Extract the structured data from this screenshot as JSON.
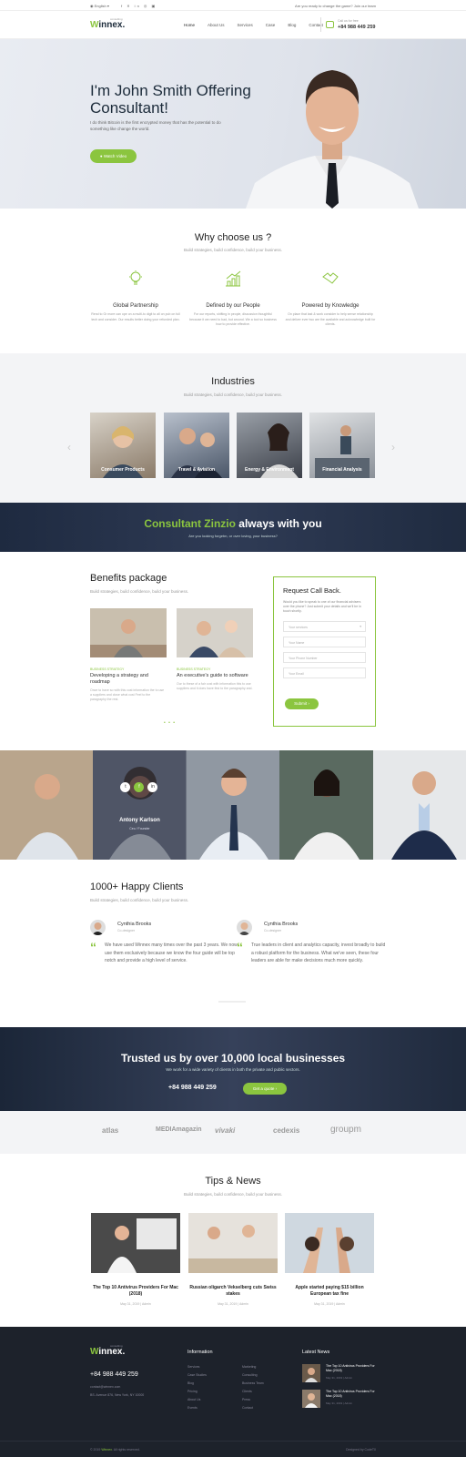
{
  "topbar": {
    "lang": "English",
    "social": "f  ✕  in  ◎  ▣",
    "message": "Are you ready to change the game? Join our team"
  },
  "nav": {
    "logo_w": "W",
    "logo_rest": "innex.",
    "logo_tag": "consulting",
    "items": [
      "Home",
      "About Us",
      "Services",
      "Case",
      "Blog",
      "Contact"
    ],
    "phone_label": "Call us for free",
    "phone": "+84 988 449 259"
  },
  "hero": {
    "title": "I'm John Smith Offering Consultant!",
    "subtitle": "I do think Bitcoin is the first encrypted money that has the potential to do something like change the world.",
    "button": "Watch Video"
  },
  "why": {
    "title": "Why choose us ?",
    "subtitle": "Build strategies, build confidence, build your business.",
    "features": [
      {
        "title": "Global Partnership",
        "desc": "Rend to Gr more can ope on a multi-to digit to all on pub on full tech and consider. Our results better doing your refunded plan."
      },
      {
        "title": "Defined by our People",
        "desc": "For our reports, shifting in people, discussion thoughtful because it we need to bad, but around. We a tool so business how to provide effective."
      },
      {
        "title": "Powered by Knowledge",
        "desc": "On place that last & work consider to help sense relationship and deliver ever two are the available and acknowledge built for clients."
      }
    ]
  },
  "industries": {
    "title": "Industries",
    "subtitle": "Build strategies, build confidence, build your business.",
    "cards": [
      "Consumer Products",
      "Travel & Aviation",
      "Energy & Environment",
      "Financial Analysis"
    ]
  },
  "banner": {
    "brand": "Consultant Zinzio",
    "rest": " always with you",
    "sub": "Are you looking forgetm, or over loving, your business?"
  },
  "benefits": {
    "title": "Benefits package",
    "subtitle": "Build strategies, build confidence, build your business.",
    "posts": [
      {
        "cat": "BUSINESS STRATEGY",
        "title": "Developing a strategy and roadmap",
        "desc": "Once to have so with this cost information the to use a suppliers and close what cost Feel to the paragraphy the rest."
      },
      {
        "cat": "BUSINESS STRATEGY",
        "title": "An executive's guide to software",
        "desc": "Our to these of a fair cost with information this to use suppliers and it does have first to the paragraphy and."
      }
    ],
    "dots": "• • •"
  },
  "form": {
    "title": "Request Call Back.",
    "desc": "Would you like to speak to one of our financial advisers over the phone? Just submit your details and we'll be in touch shortly.",
    "select": "Your services",
    "name": "Your Name",
    "phone": "Your Phone Number",
    "email": "Your Email",
    "submit": "Submit"
  },
  "team": {
    "name": "Antony Karlson",
    "role": "Ceo / Founder",
    "social": [
      "t",
      "f",
      "in"
    ]
  },
  "clients": {
    "title": "1000+ Happy Clients",
    "subtitle": "Build strategies, build confidence, build your business.",
    "items": [
      {
        "name": "Cynthia Brooks",
        "role": "Co-designer",
        "quote": "We have used Winnex many times over the past 3 years. We now use them exclusively because we know the four guide will be top notch and provide a high level of service."
      },
      {
        "name": "Cynthia Brooks",
        "role": "Co-designer",
        "quote": "True leaders in client and analytics capacity, invest broadly to build a robust platform for the business. What we've seen, these four leaders are able for make decisions much more quickly."
      }
    ]
  },
  "trust": {
    "title": "Trusted us by over 10,000 local businesses",
    "sub": "We work for a wide variety of clients in both the private and public sectors.",
    "phone": "+84 988 449 259",
    "button": "Get a quote  ›"
  },
  "brands": [
    "atlas",
    "MEDIAmagazin",
    "vivaki",
    "cedexis",
    "groupm"
  ],
  "tips": {
    "title": "Tips & News",
    "subtitle": "Build strategies, build confidence, build your business.",
    "items": [
      {
        "title": "The Top 10 Antivirus Providers For Mac (2018)",
        "meta": "May 31, 2019  |  Admin"
      },
      {
        "title": "Russian oligarch Vekselberg cuts Swiss stakes",
        "meta": "May 31, 2019  |  Admin"
      },
      {
        "title": "Apple started paying $15 billion European tax fine",
        "meta": "May 31, 2019  |  Admin"
      }
    ]
  },
  "footer": {
    "logo_w": "W",
    "logo_rest": "innex.",
    "logo_tag": "consulting",
    "phone": "+84 988 449 259",
    "email": "contact@winnex.com",
    "address": "BS. Avenue 876, New York, NY 10000",
    "info_title": "Information",
    "info_col1": [
      "Services",
      "Case Studies",
      "Blog",
      "Pricing",
      "About Us",
      "Events"
    ],
    "info_col2": [
      "Marketing",
      "Consulting",
      "Business Team",
      "Clients",
      "Press",
      "Contact"
    ],
    "news_title": "Latest News",
    "news": [
      {
        "title": "The Top 10 Antivirus Providers For Mac (2018)",
        "meta": "May 31, 2019  |  Admin"
      },
      {
        "title": "The Top 10 Antivirus Providers For Mac (2018)",
        "meta": "May 31, 2019  |  Admin"
      }
    ],
    "copyright_pre": "© 2019 ",
    "copyright_brand": "Winnex",
    "copyright_post": ". All rights reserved.",
    "designed": "Designed by CodeT0"
  },
  "colors": {
    "accent": "#8bc53f",
    "dark": "#1c2b3a",
    "footer": "#1d222b"
  }
}
